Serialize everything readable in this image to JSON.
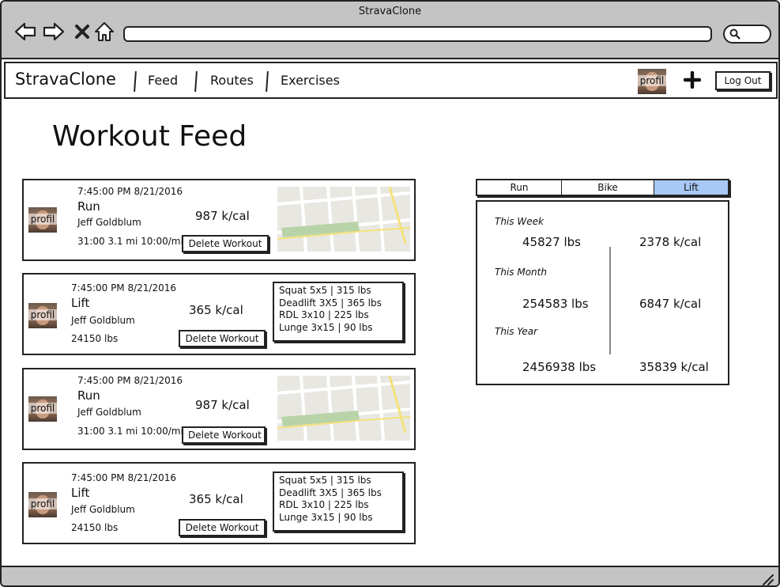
{
  "browser": {
    "title": "StravaClone",
    "back_icon": "back-arrow-icon",
    "forward_icon": "forward-arrow-icon",
    "close_icon": "close-icon",
    "home_icon": "home-icon",
    "url": "",
    "search_icon": "search-icon"
  },
  "navbar": {
    "brand": "StravaClone",
    "links": [
      "Feed",
      "Routes",
      "Exercises"
    ],
    "avatar_label": "profil",
    "add_icon": "plus-icon",
    "logout_label": "Log Out"
  },
  "page": {
    "title": "Workout Feed"
  },
  "feed": [
    {
      "timestamp": "7:45:00 PM 8/21/2016",
      "type": "Run",
      "user": "Jeff Goldblum",
      "calories": "987 k/cal",
      "summary": "31:00 3.1 mi 10:00/mi",
      "avatar_label": "profil",
      "delete_label": "Delete Workout"
    },
    {
      "timestamp": "7:45:00 PM 8/21/2016",
      "type": "Lift",
      "user": "Jeff Goldblum",
      "calories": "365 k/cal",
      "summary": "24150 lbs",
      "avatar_label": "profil",
      "delete_label": "Delete Workout",
      "exercises": [
        "Squat 5x5 | 315 lbs",
        "Deadlift 3X5 | 365 lbs",
        "RDL 3x10 | 225 lbs",
        "Lunge 3x15 | 90 lbs"
      ]
    },
    {
      "timestamp": "7:45:00 PM 8/21/2016",
      "type": "Run",
      "user": "Jeff Goldblum",
      "calories": "987 k/cal",
      "summary": "31:00 3.1 mi 10:00/mi",
      "avatar_label": "profil",
      "delete_label": "Delete Workout"
    },
    {
      "timestamp": "7:45:00 PM 8/21/2016",
      "type": "Lift",
      "user": "Jeff Goldblum",
      "calories": "365 k/cal",
      "summary": "24150 lbs",
      "avatar_label": "profil",
      "delete_label": "Delete Workout",
      "exercises": [
        "Squat 5x5 | 315 lbs",
        "Deadlift 3X5 | 365 lbs",
        "RDL 3x10 | 225 lbs",
        "Lunge 3x15 | 90 lbs"
      ]
    }
  ],
  "stats": {
    "tabs": [
      "Run",
      "Bike",
      "Lift"
    ],
    "active_tab": "Lift",
    "active_color": "#a8c8f5",
    "periods": [
      {
        "label": "This Week",
        "weight": "45827 lbs",
        "calories": "2378 k/cal"
      },
      {
        "label": "This Month",
        "weight": "254583 lbs",
        "calories": "6847 k/cal"
      },
      {
        "label": "This Year",
        "weight": "2456938 lbs",
        "calories": "35839 k/cal"
      }
    ]
  }
}
